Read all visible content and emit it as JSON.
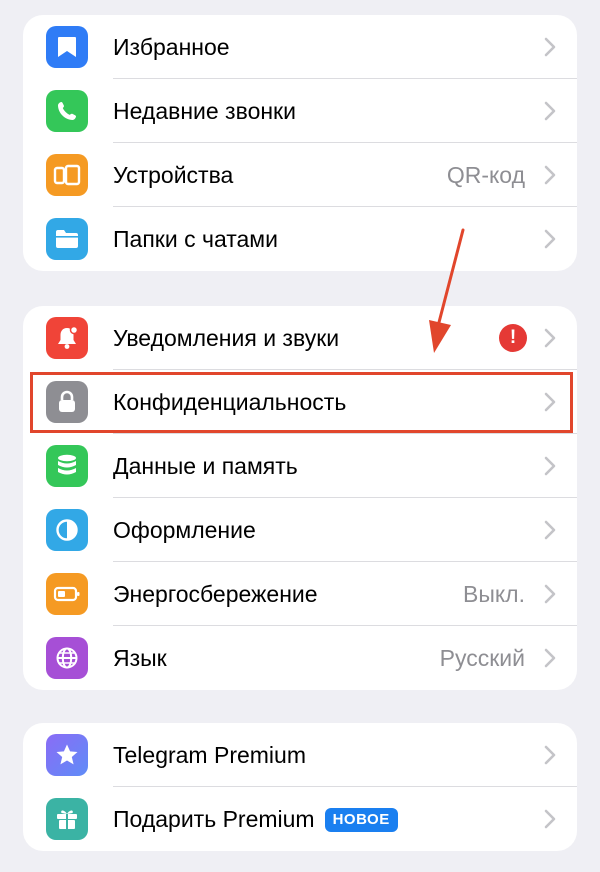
{
  "group1": {
    "items": [
      {
        "label": "Избранное",
        "icon": "bookmark-icon",
        "color": "#2f7cf6"
      },
      {
        "label": "Недавние звонки",
        "icon": "phone-icon",
        "color": "#34c759"
      },
      {
        "label": "Устройства",
        "value": "QR-код",
        "icon": "devices-icon",
        "color": "#f59a23"
      },
      {
        "label": "Папки с чатами",
        "icon": "folder-icon",
        "color": "#32a8e6"
      }
    ]
  },
  "group2": {
    "items": [
      {
        "label": "Уведомления и звуки",
        "badge": "!",
        "icon": "bell-icon",
        "color": "#f04438"
      },
      {
        "label": "Конфиденциальность",
        "icon": "lock-icon",
        "color": "#8e8e93"
      },
      {
        "label": "Данные и память",
        "icon": "database-icon",
        "color": "#34c759"
      },
      {
        "label": "Оформление",
        "icon": "contrast-icon",
        "color": "#32a8e6"
      },
      {
        "label": "Энергосбережение",
        "value": "Выкл.",
        "icon": "battery-icon",
        "color": "#f59a23"
      },
      {
        "label": "Язык",
        "value": "Русский",
        "icon": "globe-icon",
        "color": "#a64fd6"
      }
    ]
  },
  "group3": {
    "items": [
      {
        "label": "Telegram Premium",
        "icon": "star-icon",
        "color": "#7b6cf6"
      },
      {
        "label": "Подарить Premium",
        "badge": "НОВОЕ",
        "icon": "gift-icon",
        "color": "#3bb3a4"
      }
    ]
  },
  "annotation_color": "#e1462c"
}
